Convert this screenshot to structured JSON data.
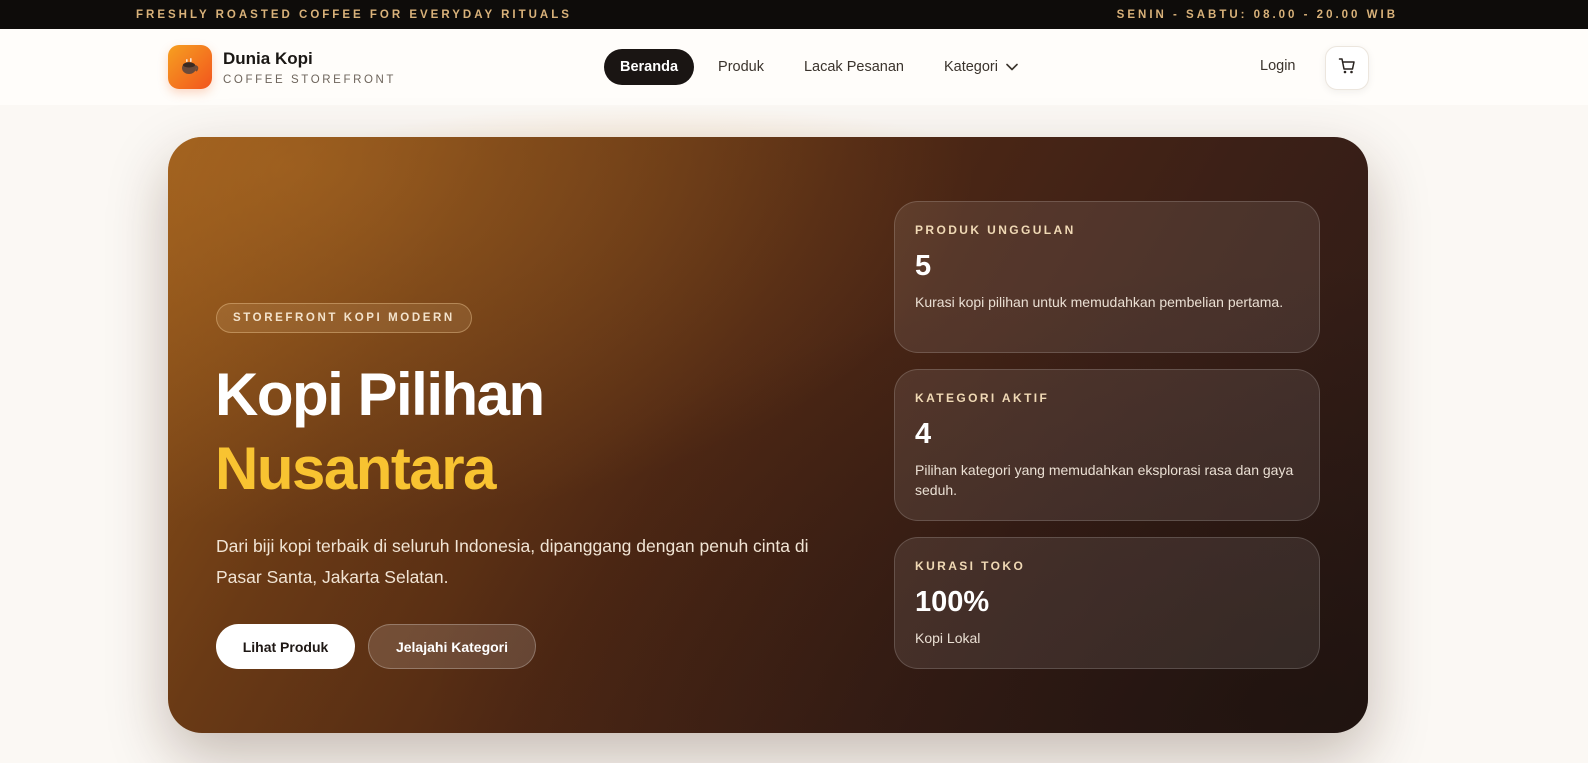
{
  "topbar": {
    "tagline": "FRESHLY ROASTED COFFEE FOR EVERYDAY RITUALS",
    "hours": "SENIN - SABTU: 08.00 - 20.00 WIB"
  },
  "brand": {
    "name": "Dunia Kopi",
    "subtitle": "COFFEE STOREFRONT",
    "logo_icon": "coffee-cup-icon"
  },
  "nav": {
    "items": [
      {
        "label": "Beranda",
        "active": true
      },
      {
        "label": "Produk",
        "active": false
      },
      {
        "label": "Lacak Pesanan",
        "active": false
      },
      {
        "label": "Kategori",
        "active": false,
        "dropdown": true
      }
    ],
    "login_label": "Login",
    "cart_icon": "shopping-cart-icon"
  },
  "hero": {
    "badge": "STOREFRONT KOPI MODERN",
    "title_line1": "Kopi Pilihan",
    "title_line2": "Nusantara",
    "description": "Dari biji kopi terbaik di seluruh Indonesia, dipanggang dengan penuh cinta di Pasar Santa, Jakarta Selatan.",
    "primary_button": "Lihat Produk",
    "secondary_button": "Jelajahi Kategori"
  },
  "stats": [
    {
      "label": "PRODUK UNGGULAN",
      "value": "5",
      "description": "Kurasi kopi pilihan untuk memudahkan pembelian pertama."
    },
    {
      "label": "KATEGORI AKTIF",
      "value": "4",
      "description": "Pilihan kategori yang memudahkan eksplorasi rasa dan gaya seduh."
    },
    {
      "label": "KURASI TOKO",
      "value": "100%",
      "description": "Kopi Lokal"
    }
  ],
  "colors": {
    "accent": "#f8c331",
    "topbar_bg": "#0e0c0a",
    "topbar_text": "#d9b27a",
    "logo_gradient": [
      "#f6a021",
      "#f2541d"
    ]
  }
}
